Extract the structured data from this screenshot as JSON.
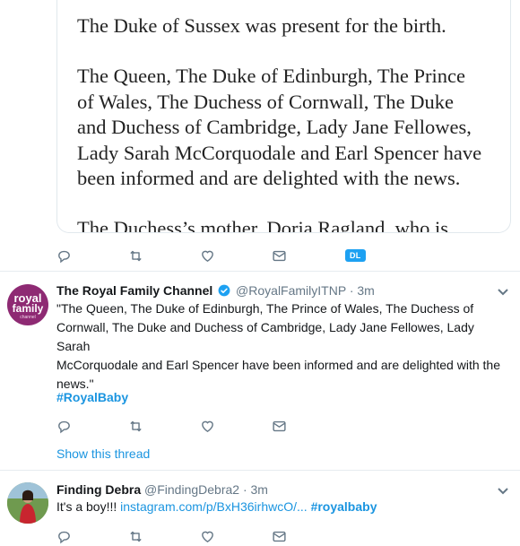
{
  "statement": {
    "line1": "The Duke of Sussex was present for the birth.",
    "para2_lines": [
      "The Queen, The Duke of Edinburgh, The Prince",
      "of Wales, The Duchess of Cornwall, The Duke",
      "and Duchess of Cambridge, Lady Jane Fellowes,",
      "Lady Sarah McCorquodale and Earl Spencer have",
      "been informed and are delighted with the news."
    ],
    "para3_partial": "The Duchess’s mother, Doria Ragland, who is"
  },
  "action_bar_1": {
    "badge_text": "DL"
  },
  "tweet_royal": {
    "avatar_lines": [
      "royal",
      "family",
      "channel"
    ],
    "name": "The Royal Family Channel",
    "handle": "@RoyalFamilyITNP",
    "time": "· 3m",
    "text_lines": [
      "\"The Queen, The Duke of Edinburgh, The Prince of Wales, The Duchess of",
      "Cornwall, The Duke and Duchess of Cambridge, Lady Jane Fellowes, Lady Sarah",
      "McCorquodale and Earl Spencer have been informed and are delighted with the",
      "news.\""
    ],
    "hashtag": "#RoyalBaby",
    "show_thread": "Show this thread"
  },
  "tweet_debra": {
    "name": "Finding Debra",
    "handle": "@FindingDebra2",
    "time": "· 3m",
    "text_prefix": "It's a boy!!! ",
    "link": "instagram.com/p/BxH36irhwcO/...",
    "hashtag": "#royalbaby"
  },
  "colors": {
    "accent": "#1b95e0",
    "verified": "#1da1f2",
    "avatar_royal": "#8e2a73"
  }
}
